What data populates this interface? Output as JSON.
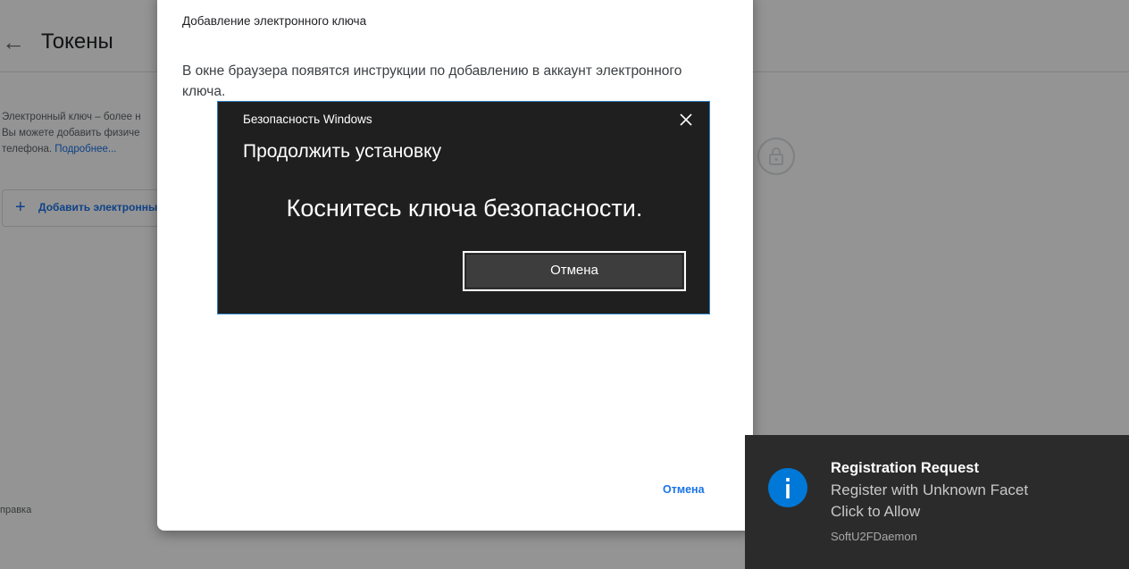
{
  "background": {
    "back_arrow": "←",
    "title": "Токены",
    "description_lines": [
      "Электронный ключ – более н",
      "Вы можете добавить физиче",
      "телефона."
    ],
    "description_link": "Подробнее...",
    "add_key_label": "Добавить электронны",
    "footer_help": "правка"
  },
  "dialog": {
    "title": "Добавление электронного ключа",
    "body": "В окне браузера появятся инструкции по добавлению в аккаунт электронного ключа.",
    "cancel_label": "Отмена"
  },
  "windows_security": {
    "window_title": "Безопасность Windows",
    "heading": "Продолжить установку",
    "message": "Коснитесь ключа безопасности.",
    "cancel_label": "Отмена",
    "border_color": "#2f7fc4"
  },
  "toast": {
    "title": "Registration Request",
    "line1": "Register with Unknown Facet",
    "line2": "Click to Allow",
    "source": "SoftU2FDaemon",
    "icon": "info-icon",
    "accent_color": "#0078d7"
  }
}
